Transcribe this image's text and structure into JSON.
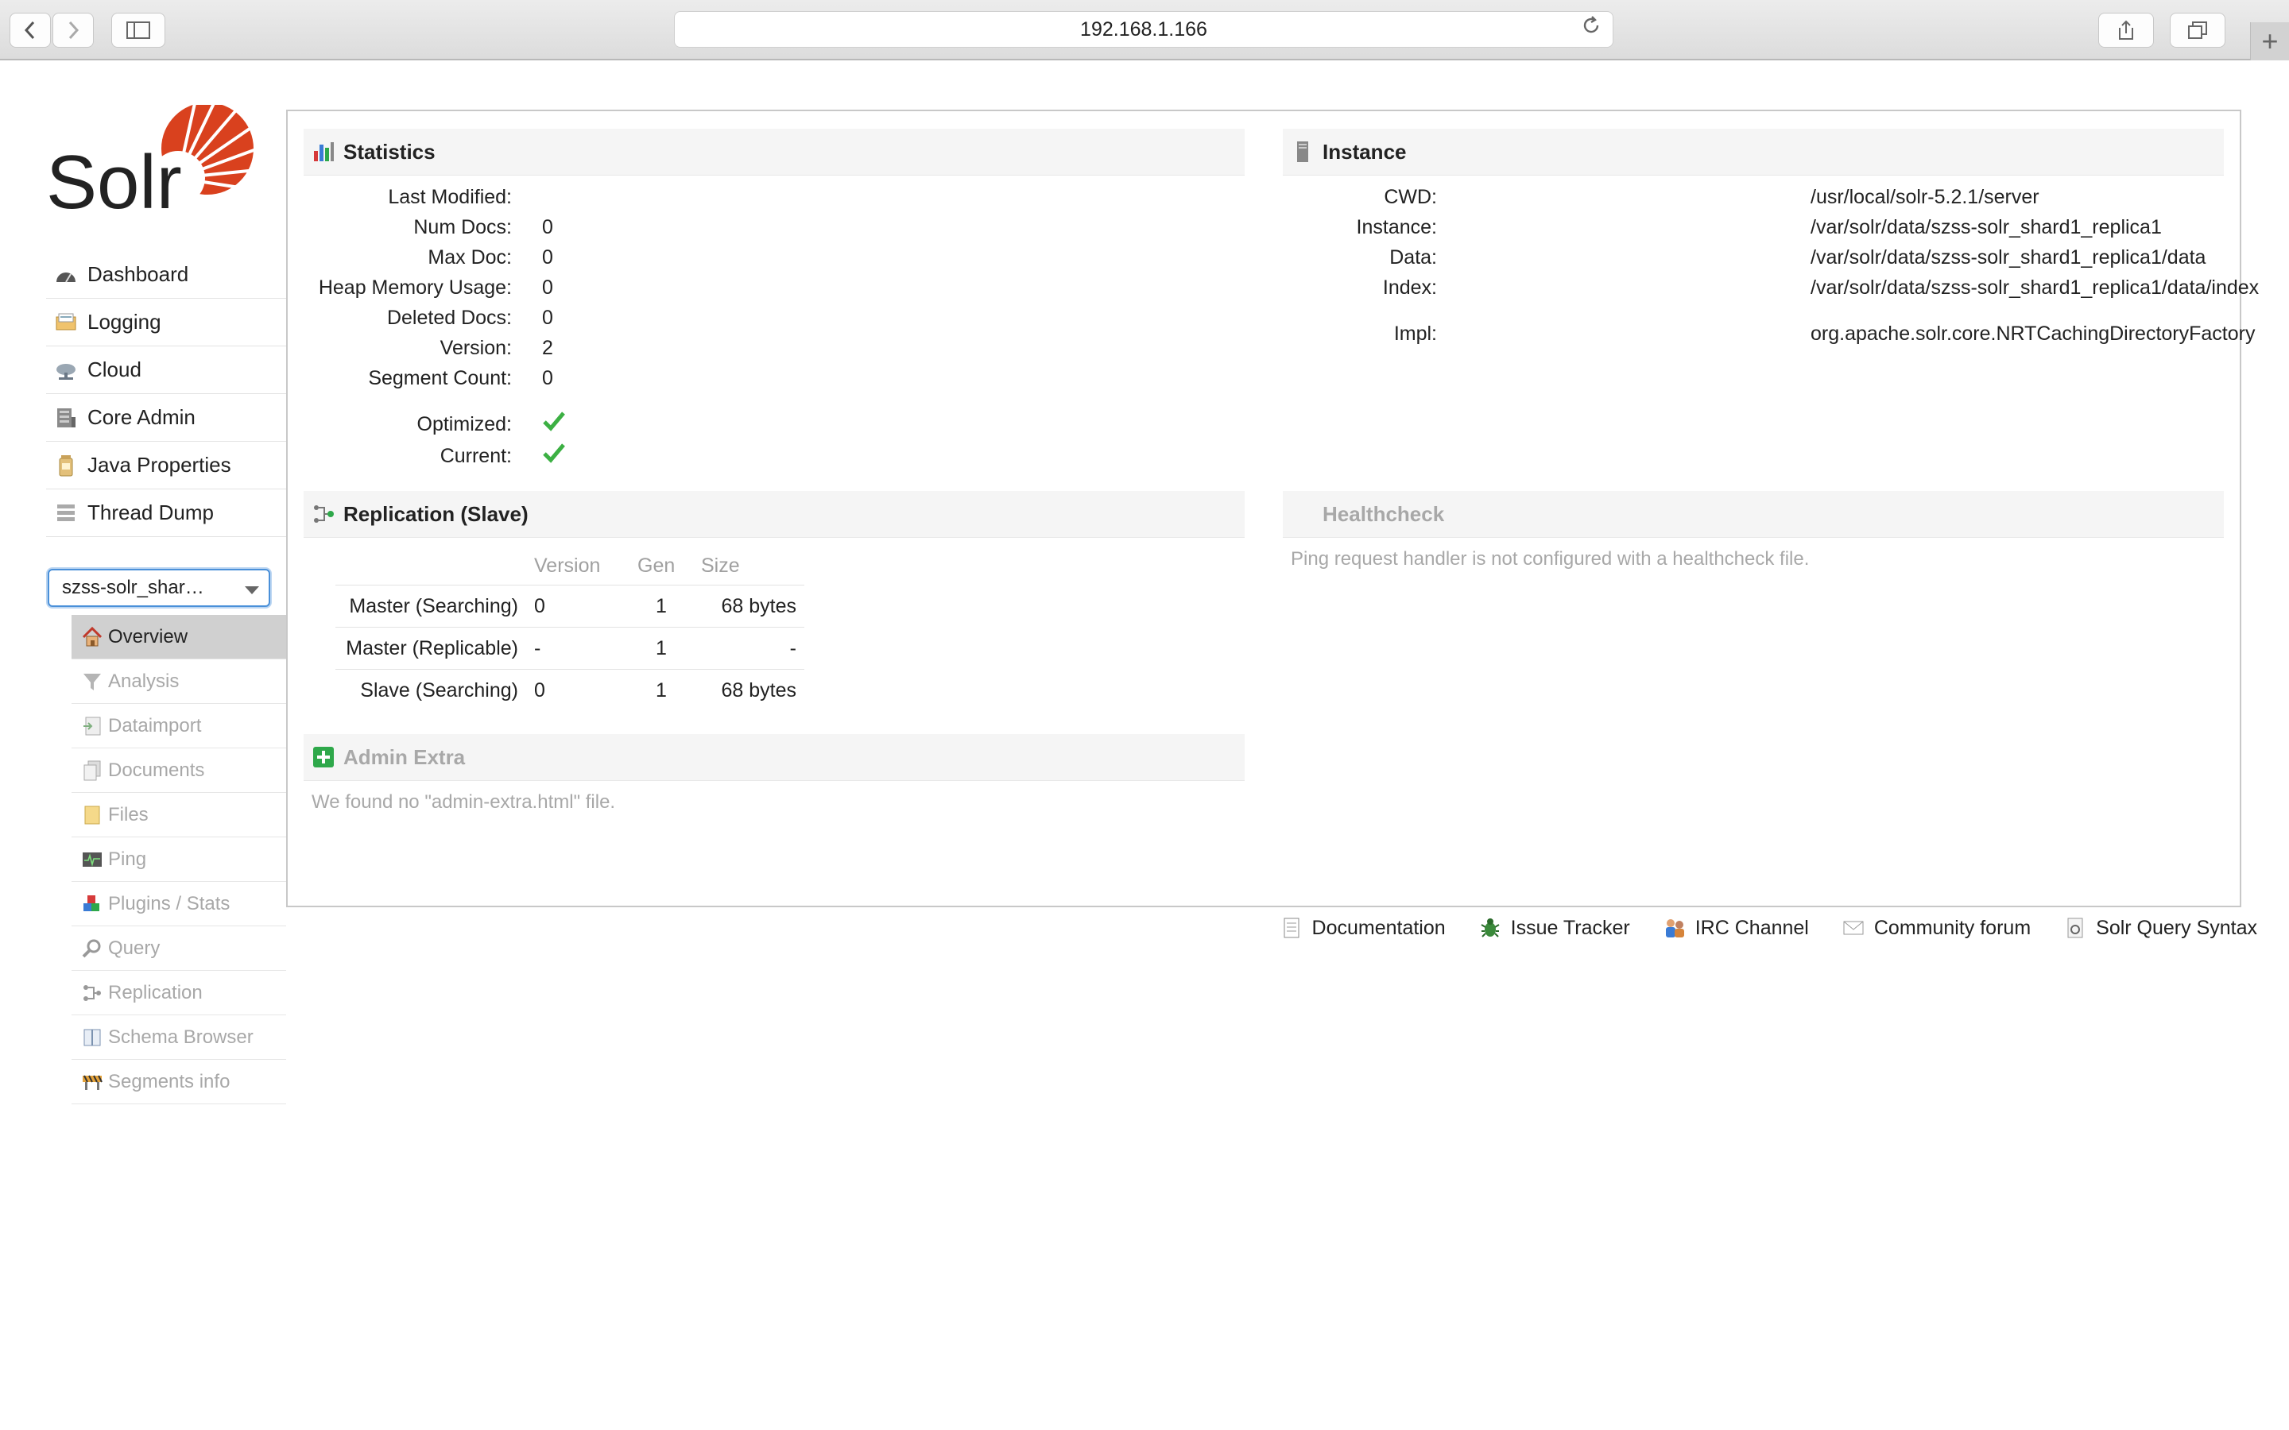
{
  "browser": {
    "url": "192.168.1.166",
    "new_tab_symbol": "+"
  },
  "logo": {
    "text": "Solr"
  },
  "sidebar": {
    "items": [
      {
        "label": "Dashboard",
        "icon": "dashboard-icon"
      },
      {
        "label": "Logging",
        "icon": "logging-icon"
      },
      {
        "label": "Cloud",
        "icon": "cloud-icon"
      },
      {
        "label": "Core Admin",
        "icon": "core-admin-icon"
      },
      {
        "label": "Java Properties",
        "icon": "java-icon"
      },
      {
        "label": "Thread Dump",
        "icon": "thread-dump-icon"
      }
    ],
    "core_selector": "szss-solr_shar…",
    "core_items": [
      {
        "label": "Overview",
        "icon": "home-icon",
        "active": true
      },
      {
        "label": "Analysis",
        "icon": "funnel-icon"
      },
      {
        "label": "Dataimport",
        "icon": "dataimport-icon"
      },
      {
        "label": "Documents",
        "icon": "documents-icon"
      },
      {
        "label": "Files",
        "icon": "files-icon"
      },
      {
        "label": "Ping",
        "icon": "ping-icon"
      },
      {
        "label": "Plugins / Stats",
        "icon": "plugins-icon"
      },
      {
        "label": "Query",
        "icon": "magnifier-icon"
      },
      {
        "label": "Replication",
        "icon": "replication-icon"
      },
      {
        "label": "Schema Browser",
        "icon": "book-icon"
      },
      {
        "label": "Segments info",
        "icon": "segments-icon"
      }
    ]
  },
  "statistics": {
    "title": "Statistics",
    "rows": [
      {
        "key": "Last Modified:",
        "value": ""
      },
      {
        "key": "Num Docs:",
        "value": "0"
      },
      {
        "key": "Max Doc:",
        "value": "0"
      },
      {
        "key": "Heap Memory Usage:",
        "value": "0"
      },
      {
        "key": "Deleted Docs:",
        "value": "0"
      },
      {
        "key": "Version:",
        "value": "2"
      },
      {
        "key": "Segment Count:",
        "value": "0"
      }
    ],
    "flags": [
      {
        "key": "Optimized:",
        "value": "check-icon"
      },
      {
        "key": "Current:",
        "value": "check-icon"
      }
    ]
  },
  "instance": {
    "title": "Instance",
    "rows": [
      {
        "key": "CWD:",
        "value": "/usr/local/solr-5.2.1/server"
      },
      {
        "key": "Instance:",
        "value": "/var/solr/data/szss-solr_shard1_replica1"
      },
      {
        "key": "Data:",
        "value": "/var/solr/data/szss-solr_shard1_replica1/data"
      },
      {
        "key": "Index:",
        "value": "/var/solr/data/szss-solr_shard1_replica1/data/index"
      }
    ],
    "impl": {
      "key": "Impl:",
      "value": "org.apache.solr.core.NRTCachingDirectoryFactory"
    }
  },
  "replication": {
    "title": "Replication (Slave)",
    "columns": [
      "Version",
      "Gen",
      "Size"
    ],
    "rows": [
      {
        "name": "Master (Searching)",
        "version": "0",
        "gen": "1",
        "size": "68 bytes"
      },
      {
        "name": "Master (Replicable)",
        "version": "-",
        "gen": "1",
        "size": "-"
      },
      {
        "name": "Slave (Searching)",
        "version": "0",
        "gen": "1",
        "size": "68 bytes"
      }
    ]
  },
  "healthcheck": {
    "title": "Healthcheck",
    "message": "Ping request handler is not configured with a healthcheck file."
  },
  "admin_extra": {
    "title": "Admin Extra",
    "message": "We found no \"admin-extra.html\" file."
  },
  "footer": {
    "links": [
      {
        "label": "Documentation",
        "icon": "document-icon"
      },
      {
        "label": "Issue Tracker",
        "icon": "bug-icon"
      },
      {
        "label": "IRC Channel",
        "icon": "irc-icon"
      },
      {
        "label": "Community forum",
        "icon": "mail-icon"
      },
      {
        "label": "Solr Query Syntax",
        "icon": "syntax-icon"
      }
    ]
  }
}
